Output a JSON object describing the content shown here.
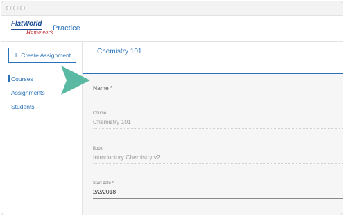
{
  "app": {
    "logo_main": "FlatWorld",
    "logo_sub": "Homework",
    "title": "Practice"
  },
  "sidebar": {
    "create_label": "Create Assignment",
    "items": [
      {
        "label": "Courses"
      },
      {
        "label": "Assignments"
      },
      {
        "label": "Students"
      }
    ]
  },
  "main": {
    "title": "Chemistry 101",
    "name_label": "Name *",
    "course": {
      "label": "Course",
      "value": "Chemistry 101"
    },
    "book": {
      "label": "Book",
      "value": "Introductory Chemistry v2"
    },
    "start_date": {
      "label": "Start date *",
      "value": "2/2/2018"
    }
  },
  "colors": {
    "accent": "#2b73b8",
    "arrow": "#5ab9a3"
  }
}
